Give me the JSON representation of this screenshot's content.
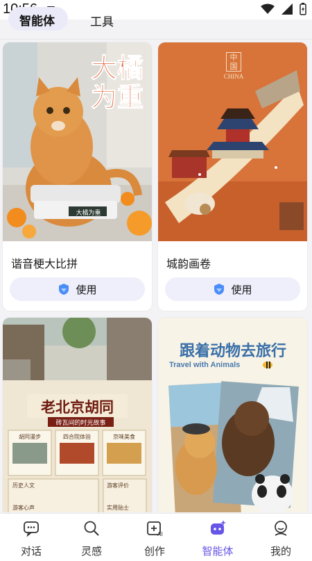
{
  "status_bar": {
    "time": "10:56"
  },
  "top_tabs": {
    "agents_label": "智能体",
    "tools_label": "工具",
    "active": "agents"
  },
  "cards": [
    {
      "title": "谐音梗大比拼",
      "button_label": "使用",
      "image_text": "大橘为重",
      "image_caption": "大橘为重"
    },
    {
      "title": "城韵画卷",
      "button_label": "使用",
      "image_text": "中国",
      "image_subtext": "CHINA"
    },
    {
      "image_title": "老北京胡同",
      "image_subtitle": "砖瓦间的时光故事",
      "image_labels": [
        "胡同漫步",
        "四合院体验",
        "京味美食",
        "历史人文",
        "游客评价",
        "游客心声",
        "实用贴士"
      ]
    },
    {
      "image_title": "跟着动物去旅行",
      "image_subtitle": "Travel with Animals"
    }
  ],
  "bottom_nav": {
    "items": [
      {
        "label": "对话",
        "icon": "chat-icon"
      },
      {
        "label": "灵感",
        "icon": "search-icon"
      },
      {
        "label": "创作",
        "icon": "create-ai-icon"
      },
      {
        "label": "智能体",
        "icon": "agent-icon"
      },
      {
        "label": "我的",
        "icon": "profile-icon"
      }
    ],
    "active_index": 3
  },
  "colors": {
    "accent": "#6655e6",
    "tab_pill": "#ebeaf8",
    "button_bg": "#eeeffb"
  }
}
